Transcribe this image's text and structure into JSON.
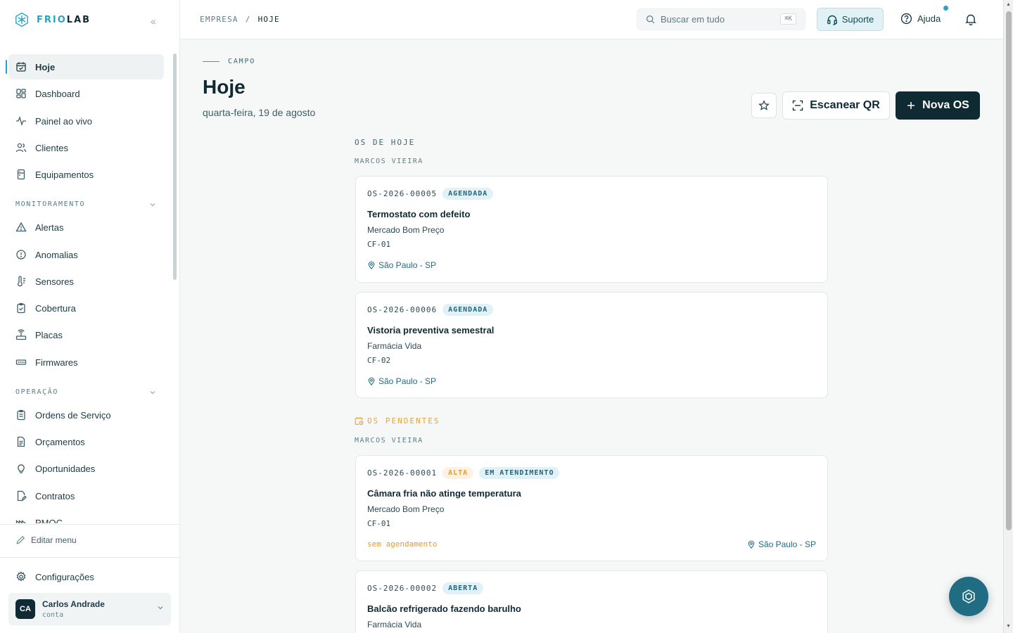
{
  "brand": {
    "part1": "FRIO",
    "part2": "LAB"
  },
  "sidebar": {
    "items": [
      {
        "label": "Hoje"
      },
      {
        "label": "Dashboard"
      },
      {
        "label": "Painel ao vivo"
      },
      {
        "label": "Clientes"
      },
      {
        "label": "Equipamentos"
      }
    ],
    "section_monitor": "MONITORAMENTO",
    "monitor_items": [
      {
        "label": "Alertas"
      },
      {
        "label": "Anomalias"
      },
      {
        "label": "Sensores"
      },
      {
        "label": "Cobertura"
      },
      {
        "label": "Placas"
      },
      {
        "label": "Firmwares"
      }
    ],
    "section_ops": "OPERAÇÃO",
    "ops_items": [
      {
        "label": "Ordens de Serviço"
      },
      {
        "label": "Orçamentos"
      },
      {
        "label": "Oportunidades"
      },
      {
        "label": "Contratos"
      },
      {
        "label": "PMOC"
      }
    ],
    "edit_menu": "Editar menu",
    "settings": "Configurações",
    "user": {
      "initials": "CA",
      "name": "Carlos Andrade",
      "sub": "conta"
    }
  },
  "topbar": {
    "breadcrumb": [
      "EMPRESA",
      "/",
      "HOJE"
    ],
    "search_placeholder": "Buscar em tudo",
    "search_shortcut": "⌘K",
    "support_label": "Suporte",
    "help_label": "Ajuda"
  },
  "page": {
    "kicker": "CAMPO",
    "title": "Hoje",
    "date": "quarta-feira, 19 de agosto",
    "scan_label": "Escanear QR",
    "new_label": "Nova OS",
    "today_section": "OS DE HOJE",
    "pending_section": "OS PENDENTES",
    "tech_today": "MARCOS VIEIRA",
    "tech_pending": "MARCOS VIEIRA"
  },
  "today_orders": [
    {
      "code": "OS-2026-00005",
      "status": "AGENDADA",
      "title": "Termostato com defeito",
      "client": "Mercado Bom Preço",
      "equipment": "CF-01",
      "location": "São Paulo - SP"
    },
    {
      "code": "OS-2026-00006",
      "status": "AGENDADA",
      "title": "Vistoria preventiva semestral",
      "client": "Farmácia Vida",
      "equipment": "CF-02",
      "location": "São Paulo - SP"
    }
  ],
  "pending_orders": [
    {
      "code": "OS-2026-00001",
      "priority": "ALTA",
      "status": "EM ATENDIMENTO",
      "title": "Câmara fria não atinge temperatura",
      "client": "Mercado Bom Preço",
      "equipment": "CF-01",
      "schedule": "sem agendamento",
      "location": "São Paulo - SP"
    },
    {
      "code": "OS-2026-00002",
      "status": "ABERTA",
      "title": "Balcão refrigerado fazendo barulho",
      "client": "Farmácia Vida"
    }
  ],
  "colors": {
    "accent": "#29a3c4",
    "primary": "#0f2a33",
    "warning": "#e09a3a"
  }
}
